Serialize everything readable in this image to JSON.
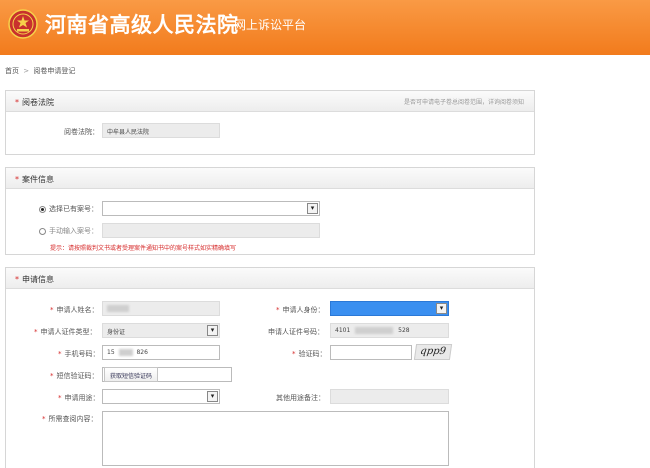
{
  "header": {
    "title": "河南省高级人民法院",
    "subtitle": "网上诉讼平台",
    "bg_color": "#f48b2e"
  },
  "breadcrumb": {
    "home": "首页",
    "separator": ">",
    "current": "阅卷申请登记"
  },
  "court_section": {
    "star": "*",
    "title": "阅卷法院",
    "hint": "是否可申请电子卷总阅卷范围，详询阅卷须知",
    "court_label": "阅卷法院：",
    "court_value": "中牟县人民法院"
  },
  "case_section": {
    "star": "*",
    "title": "案件信息",
    "select_option_label": "选择已有案号：",
    "select_value": "",
    "manual_option_label": "手动输入案号：",
    "manual_value": "",
    "warning": "提示：请按照裁判文书或者受理案件通知书中的案号样式如实精确填写"
  },
  "applicant_section": {
    "star": "*",
    "title": "申请信息",
    "name_label": "申请人姓名：",
    "identity_label": "申请人身份：",
    "identity_value": "",
    "idtype_label": "申请人证件类型：",
    "idtype_value": "身份证",
    "idnum_label": "申请人证件号码：",
    "idnum_prefix": "4101",
    "idnum_suffix": "528",
    "phone_label": "手机号码：",
    "phone_prefix": "15",
    "phone_suffix": "826",
    "verify_label": "验证码：",
    "verify_value": "",
    "captcha_text": "qpp9",
    "sms_label": "短信验证码：",
    "sms_button": "获取短信验证码",
    "purpose_label": "申请用途：",
    "purpose_value": "",
    "other_purpose_label": "其他用途备注：",
    "other_purpose_value": "",
    "content_label": "所需查阅内容："
  }
}
